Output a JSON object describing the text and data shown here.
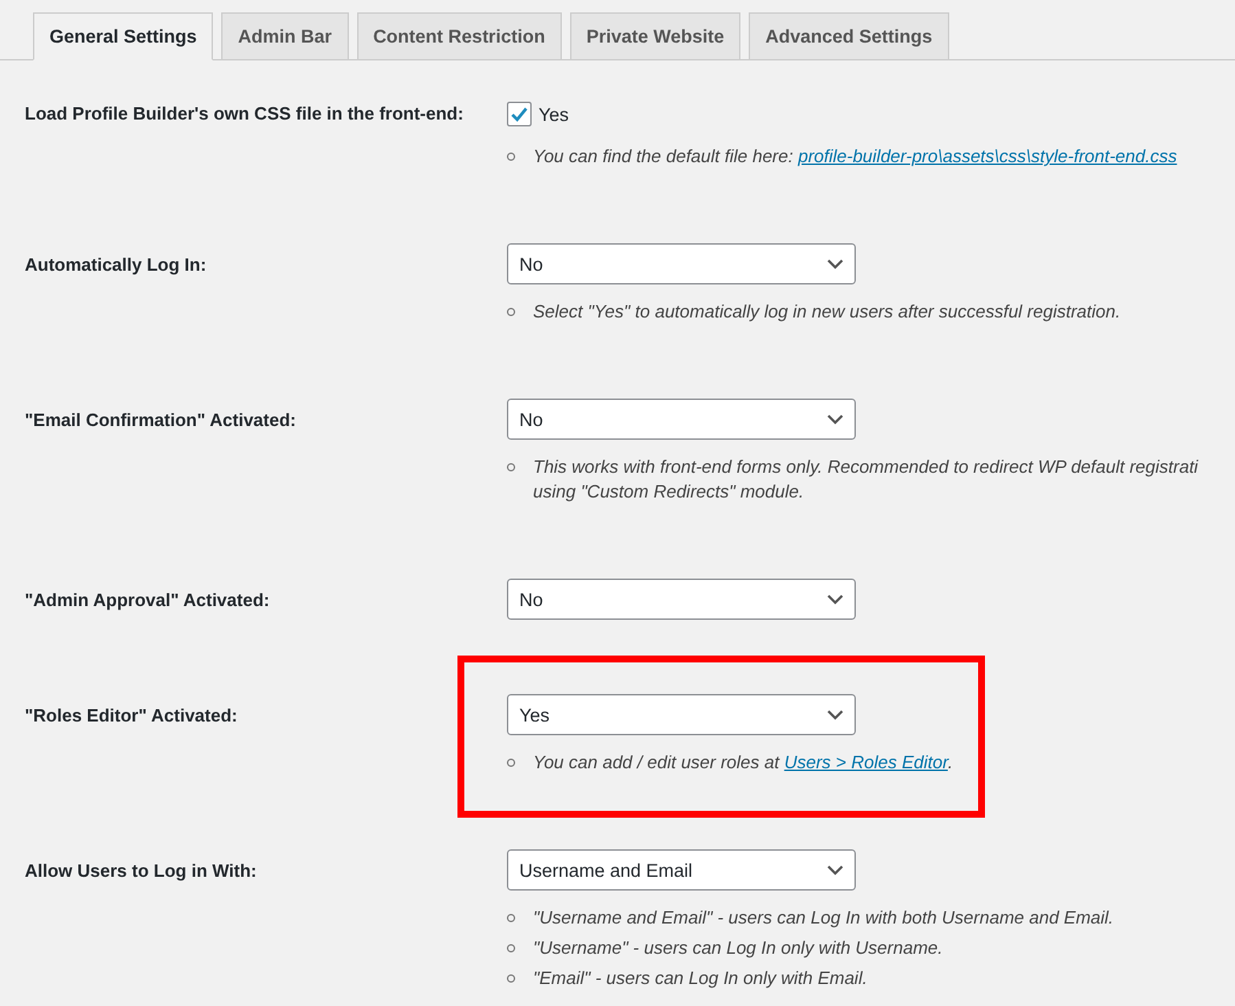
{
  "tabs": [
    {
      "label": "General Settings",
      "selected": true
    },
    {
      "label": "Admin Bar",
      "selected": false
    },
    {
      "label": "Content Restriction",
      "selected": false
    },
    {
      "label": "Private Website",
      "selected": false
    },
    {
      "label": "Advanced Settings",
      "selected": false
    }
  ],
  "settings": [
    {
      "label": "Load Profile Builder's own CSS file in the front-end:",
      "kind": "checkbox",
      "checked": true,
      "value": "Yes",
      "highlighted": false,
      "notes": [
        {
          "text": "You can find the default file here: ",
          "link": "profile-builder-pro\\assets\\css\\style-front-end.css"
        }
      ]
    },
    {
      "label": "Automatically Log In:",
      "kind": "select",
      "value": "No",
      "highlighted": false,
      "notes": [
        {
          "text": "Select \"Yes\" to automatically log in new users after successful registration."
        }
      ]
    },
    {
      "label": "\"Email Confirmation\" Activated:",
      "kind": "select",
      "value": "No",
      "highlighted": false,
      "notes": [
        {
          "text": "This works with front-end forms only. Recommended to redirect WP default registrati using \"Custom Redirects\" module."
        }
      ]
    },
    {
      "label": "\"Admin Approval\" Activated:",
      "kind": "select",
      "value": "No",
      "highlighted": false
    },
    {
      "label": "\"Roles Editor\" Activated:",
      "kind": "select",
      "value": "Yes",
      "highlighted": true,
      "notes": [
        {
          "text": "You can add / edit user roles at ",
          "link": "Users > Roles Editor",
          "after": "."
        }
      ]
    },
    {
      "label": "Allow Users to Log in With:",
      "kind": "select",
      "value": "Username and Email",
      "highlighted": false,
      "notes": [
        {
          "text": "\"Username and Email\" - users can Log In with both Username and Email."
        },
        {
          "text": "\"Username\" - users can Log In only with Username."
        },
        {
          "text": "\"Email\" - users can Log In only with Email."
        }
      ]
    }
  ]
}
